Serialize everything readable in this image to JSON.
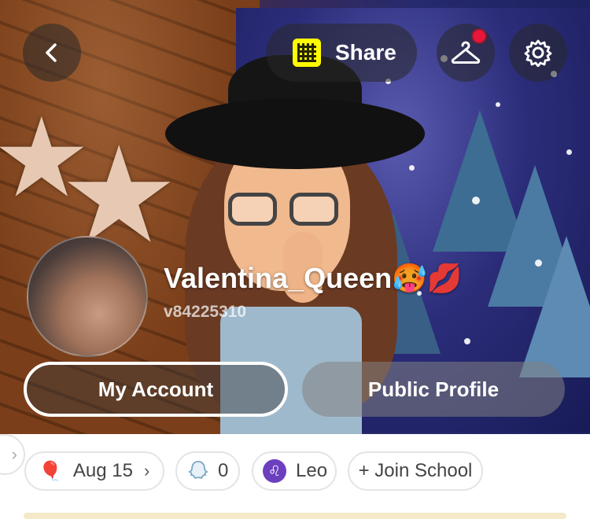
{
  "header": {
    "share_label": "Share"
  },
  "profile": {
    "display_name": "Valentina_Queen🥵💋",
    "user_id": "v84225310"
  },
  "actions": {
    "my_account_label": "My Account",
    "public_profile_label": "Public Profile"
  },
  "chips": {
    "birthday": {
      "icon": "🎈",
      "label": "Aug 15"
    },
    "snapscore": {
      "label": "0"
    },
    "zodiac": {
      "icon": "♌",
      "label": "Leo"
    },
    "school": {
      "label": "+ Join School"
    }
  },
  "colors": {
    "accent": "#fffc00",
    "notification": "#e8163b",
    "zodiac_badge": "#6c3fbf"
  }
}
